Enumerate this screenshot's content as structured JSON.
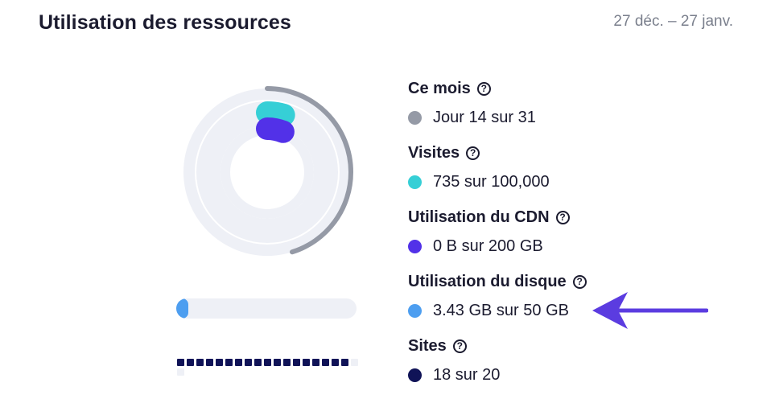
{
  "header": {
    "title": "Utilisation des ressources",
    "date_range": "27 déc. – 27 janv."
  },
  "colors": {
    "month": "#959aa6",
    "visits": "#36cfd6",
    "cdn": "#5231e8",
    "disk": "#4d9ef0",
    "sites": "#101357",
    "track": "#eef0f6",
    "arrow": "#5b3ce0"
  },
  "metrics": {
    "month": {
      "label": "Ce mois",
      "value_text": "Jour 14 sur 31",
      "used": 14,
      "total": 31,
      "icon": "help-circle-icon"
    },
    "visits": {
      "label": "Visites",
      "value_text": "735 sur 100,000",
      "used": 735,
      "total": 100000,
      "icon": "help-circle-icon"
    },
    "cdn": {
      "label": "Utilisation du CDN",
      "value_text": "0 B sur 200 GB",
      "used": 0,
      "total": 200,
      "icon": "help-circle-icon"
    },
    "disk": {
      "label": "Utilisation du disque",
      "value_text": "3.43 GB sur 50 GB",
      "used": 3.43,
      "total": 50,
      "icon": "help-circle-icon"
    },
    "sites": {
      "label": "Sites",
      "value_text": "18 sur 20",
      "used": 18,
      "total": 20,
      "icon": "help-circle-icon"
    }
  },
  "annotation": {
    "icon": "left-arrow-icon"
  }
}
